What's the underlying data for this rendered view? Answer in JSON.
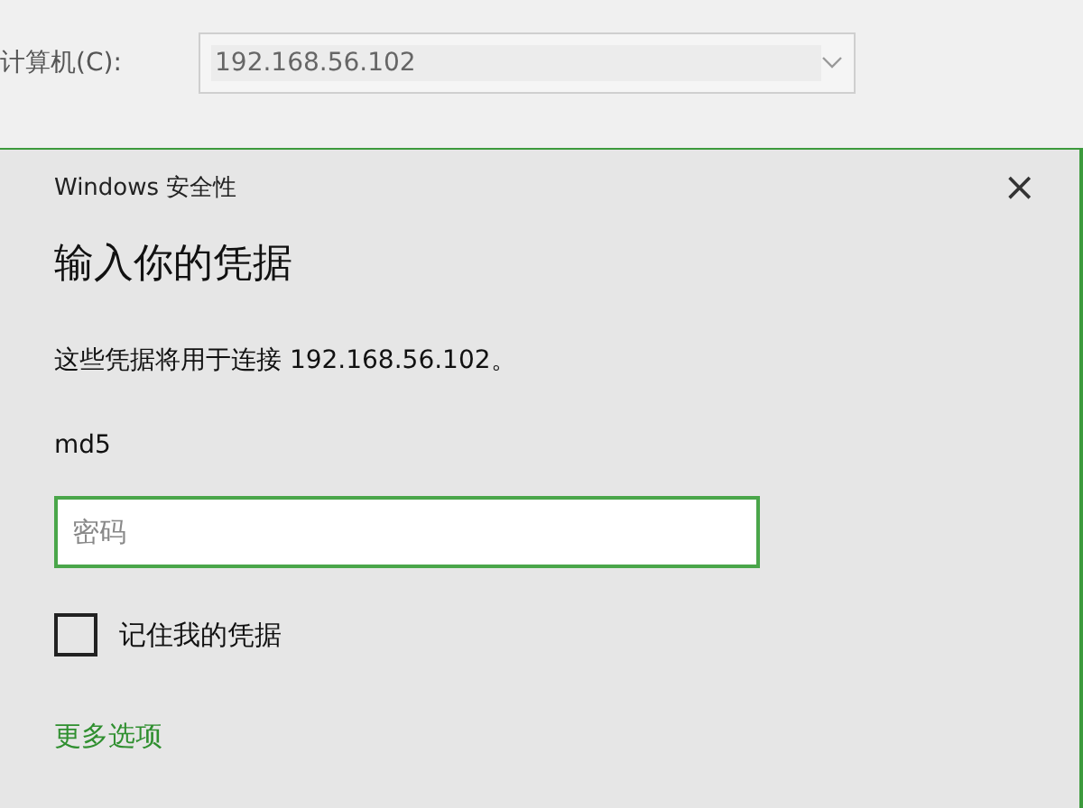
{
  "background_form": {
    "computer_label": "计算机(C):",
    "computer_value": "192.168.56.102"
  },
  "dialog": {
    "title": "Windows 安全性",
    "close": "×",
    "heading": "输入你的凭据",
    "message": "这些凭据将用于连接 192.168.56.102。",
    "username": "md5",
    "password": {
      "placeholder": "密码"
    },
    "remember": {
      "label": "记住我的凭据",
      "checked": false
    },
    "more_options": "更多选项"
  }
}
